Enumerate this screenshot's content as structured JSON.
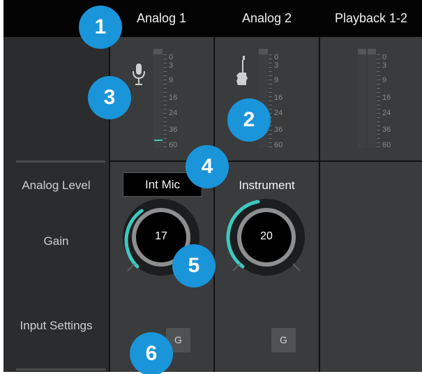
{
  "headers": [
    "Analog 1",
    "Analog 2",
    "Playback 1-2"
  ],
  "row_labels": {
    "analog_level": "Analog Level",
    "gain": "Gain",
    "input_settings": "Input Settings"
  },
  "meter_ticks": [
    "0",
    "3",
    "9",
    "16",
    "24",
    "36",
    "60"
  ],
  "channels": [
    {
      "level_select": "Int Mic",
      "gain": "17",
      "gain_button": "G",
      "icon": "microphone-icon"
    },
    {
      "level_select": "Instrument",
      "gain": "20",
      "gain_button": "G",
      "icon": "guitar-icon"
    }
  ],
  "badges": [
    "1",
    "2",
    "3",
    "4",
    "5",
    "6"
  ],
  "colors": {
    "accent": "#3cc9c0",
    "badge": "#1a95d9",
    "topbar": "#040404"
  }
}
